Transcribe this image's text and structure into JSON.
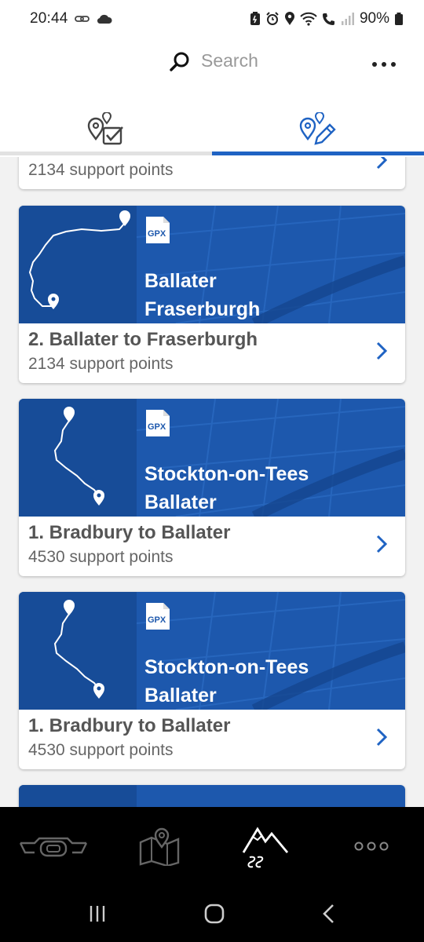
{
  "status_bar": {
    "time": "20:44",
    "battery": "90%"
  },
  "header": {
    "search_placeholder": "Search"
  },
  "tabs": [
    {
      "name": "tab-checklist",
      "active": false
    },
    {
      "name": "tab-edit-route",
      "active": true
    }
  ],
  "routes": [
    {
      "name": "",
      "support_points": "2134 support points",
      "from": "",
      "to": "",
      "partial": true
    },
    {
      "name": "2. Ballater to Fraserburgh",
      "support_points": "2134 support points",
      "from": "Ballater",
      "to": "Fraserburgh",
      "badge": "GPX"
    },
    {
      "name": "1. Bradbury to Ballater",
      "support_points": "4530 support points",
      "from": "Stockton-on-Tees",
      "to": "Ballater",
      "badge": "GPX"
    },
    {
      "name": "1. Bradbury to Ballater",
      "support_points": "4530 support points",
      "from": "Stockton-on-Tees",
      "to": "Ballater",
      "badge": "GPX"
    }
  ],
  "bottom_nav": [
    "motorcycle-icon",
    "map-icon",
    "mountain-route-icon",
    "more-icon"
  ],
  "colors": {
    "accent": "#1f63c3",
    "banner": "#1d58ad",
    "banner_dark": "#174c98",
    "chevron": "#1f63c3"
  }
}
